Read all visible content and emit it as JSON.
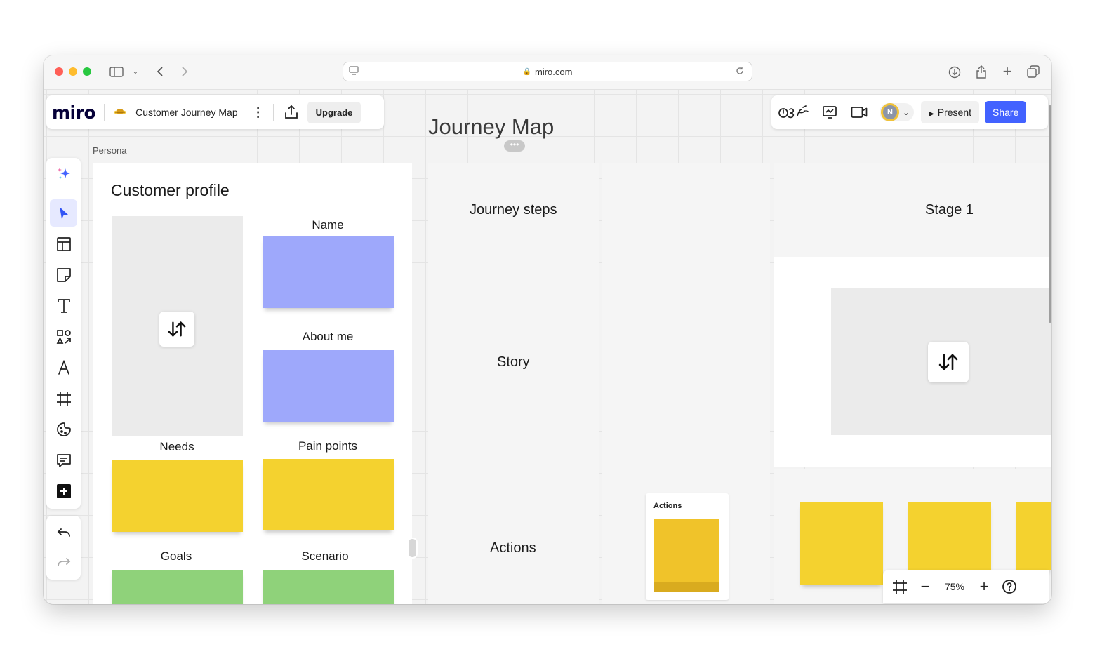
{
  "browser": {
    "url": "miro.com"
  },
  "header": {
    "logo": "miro",
    "board_title": "Customer Journey Map",
    "upgrade_label": "Upgrade",
    "avatar_initial": "N",
    "present_label": "Present",
    "share_label": "Share",
    "accent_color": "#4262ff"
  },
  "persona": {
    "frame_label": "Persona",
    "title": "Customer profile",
    "fields": {
      "name": "Name",
      "about": "About me",
      "needs": "Needs",
      "pain_points": "Pain points",
      "goals": "Goals",
      "scenario": "Scenario"
    }
  },
  "journey": {
    "title": "Journey Map",
    "rows": {
      "steps": "Journey steps",
      "story": "Story",
      "actions": "Actions"
    },
    "stage_label": "Stage 1",
    "action_card_title": "Actions"
  },
  "zoom": {
    "level": "75%"
  },
  "sticky_colors": {
    "purple": "#9ea8fb",
    "yellow": "#f4d22f",
    "green": "#8fd27a"
  }
}
